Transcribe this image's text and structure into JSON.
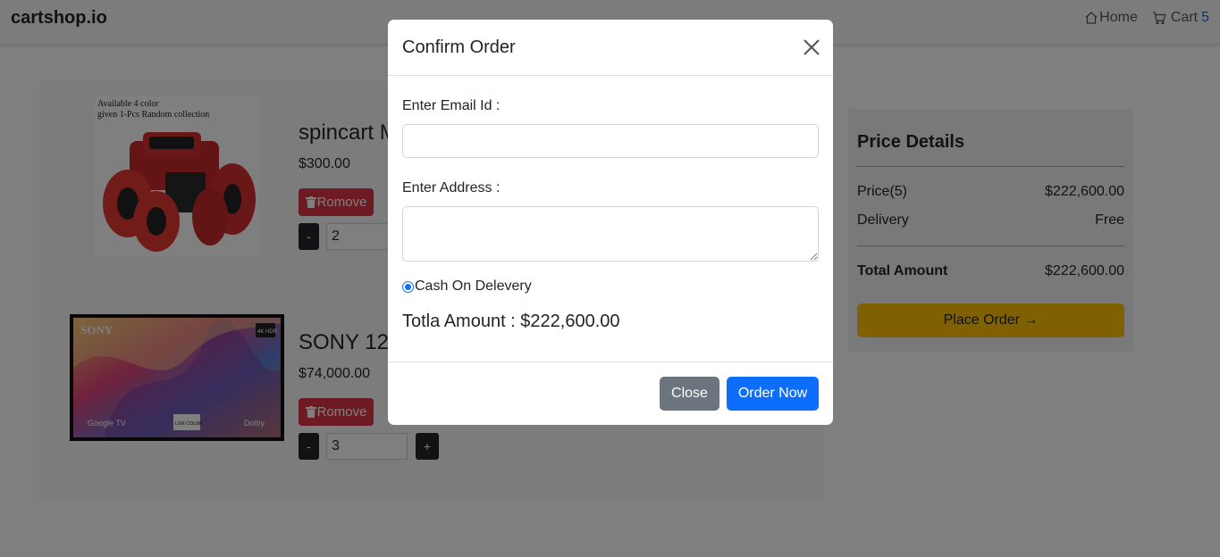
{
  "navbar": {
    "brand": "cartshop.io",
    "home_label": "Home",
    "cart_label": "Cart",
    "cart_count": "5"
  },
  "cart": {
    "items": [
      {
        "title": "spincart M",
        "price": "$300.00",
        "remove_label": "Romove",
        "quantity": "2",
        "decrement_label": "-",
        "image_caption_line1": "Available 4 color",
        "image_caption_line2": "given 1-Pcs Random collection"
      },
      {
        "title": "SONY 12",
        "price": "$74,000.00",
        "remove_label": "Romove",
        "quantity": "3",
        "decrement_label": "-",
        "increment_label": "+",
        "image_brand": "SONY",
        "image_badge": "4K HDR",
        "image_google": "Google TV",
        "image_live": "LIVE COLOR",
        "image_dolby": "Dolby"
      }
    ]
  },
  "price_details": {
    "title": "Price Details",
    "price_label": "Price(5)",
    "price_value": "$222,600.00",
    "delivery_label": "Delivery",
    "delivery_value": "Free",
    "total_label": "Total Amount",
    "total_value": "$222,600.00",
    "place_order_label": "Place Order →"
  },
  "modal": {
    "title": "Confirm Order",
    "email_label": "Enter Email Id :",
    "email_value": "",
    "address_label": "Enter Address :",
    "address_value": "",
    "payment_option": "Cash On Delevery",
    "total_text": "Totla Amount : $222,600.00",
    "close_label": "Close",
    "order_now_label": "Order Now"
  },
  "colors": {
    "primary": "#0d6efd",
    "danger": "#dc3545",
    "warning": "#ffc107",
    "secondary": "#6c757d",
    "dark": "#212529"
  }
}
